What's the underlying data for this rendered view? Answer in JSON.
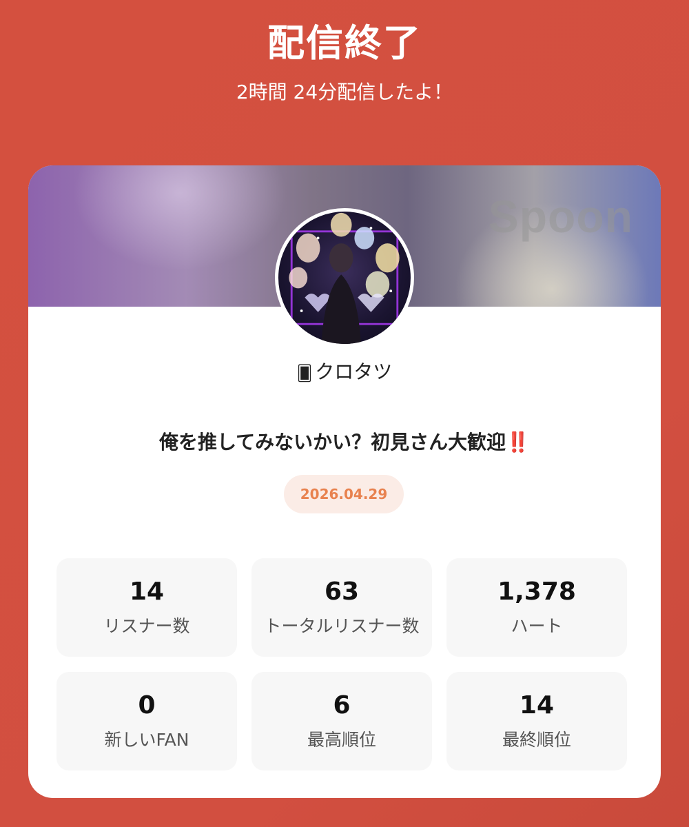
{
  "header": {
    "title": "配信終了",
    "subtitle": "2時間 24分配信したよ！"
  },
  "card": {
    "brand": "Spoon",
    "username_prefix_icon": "playing-card-icon",
    "username_prefix": "🂠",
    "username": "クロタツ",
    "stream_title": "俺を推してみないかい？初見さん大歓迎",
    "stream_title_emoji": "‼️",
    "date": "2026.04.29"
  },
  "stats": [
    {
      "value": "14",
      "label": "リスナー数"
    },
    {
      "value": "63",
      "label": "トータルリスナー数"
    },
    {
      "value": "1,378",
      "label": "ハート"
    },
    {
      "value": "0",
      "label": "新しいFAN"
    },
    {
      "value": "6",
      "label": "最高順位"
    },
    {
      "value": "14",
      "label": "最終順位"
    }
  ],
  "colors": {
    "background": "#d24f40",
    "date_text": "#e8824f",
    "date_pill": "#fbece6",
    "stat_box": "#f7f7f7"
  }
}
